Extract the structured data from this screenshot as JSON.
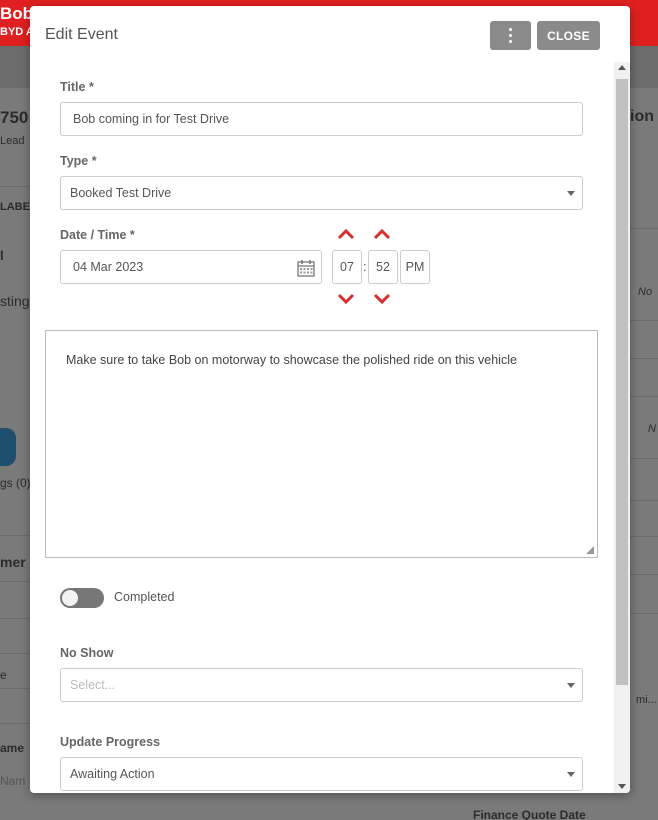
{
  "background": {
    "topbar_title": "Bob",
    "topbar_sub": "BYD A",
    "left_fragments": [
      "750",
      "Lead",
      "LABEL",
      "l",
      "sting",
      "gs (0)",
      "mer",
      "e",
      "ame",
      "Nam"
    ],
    "right_fragments": [
      "ion",
      "No",
      "N",
      "mi...",
      "Finance Quote Date"
    ],
    "colors": {
      "topbar": "#e02020",
      "overlay": "#7a7a7a"
    }
  },
  "modal": {
    "title": "Edit Event",
    "close_label": "CLOSE",
    "more_icon": "kebab-vertical-icon",
    "title_field": {
      "label": "Title *",
      "value": "Bob coming in for Test Drive"
    },
    "type_field": {
      "label": "Type *",
      "value": "Booked Test Drive"
    },
    "datetime": {
      "label": "Date / Time *",
      "date": "04 Mar 2023",
      "hour": "07",
      "minute": "52",
      "separator": ":",
      "meridiem": "PM",
      "calendar_icon": "calendar-icon",
      "accent": "#d32f2f"
    },
    "notes": "Make sure to take Bob on motorway to showcase the polished ride on this vehicle",
    "completed": {
      "label": "Completed",
      "checked": false
    },
    "no_show": {
      "label": "No Show",
      "placeholder": "Select..."
    },
    "update_progress": {
      "label": "Update Progress",
      "value": "Awaiting Action"
    }
  }
}
